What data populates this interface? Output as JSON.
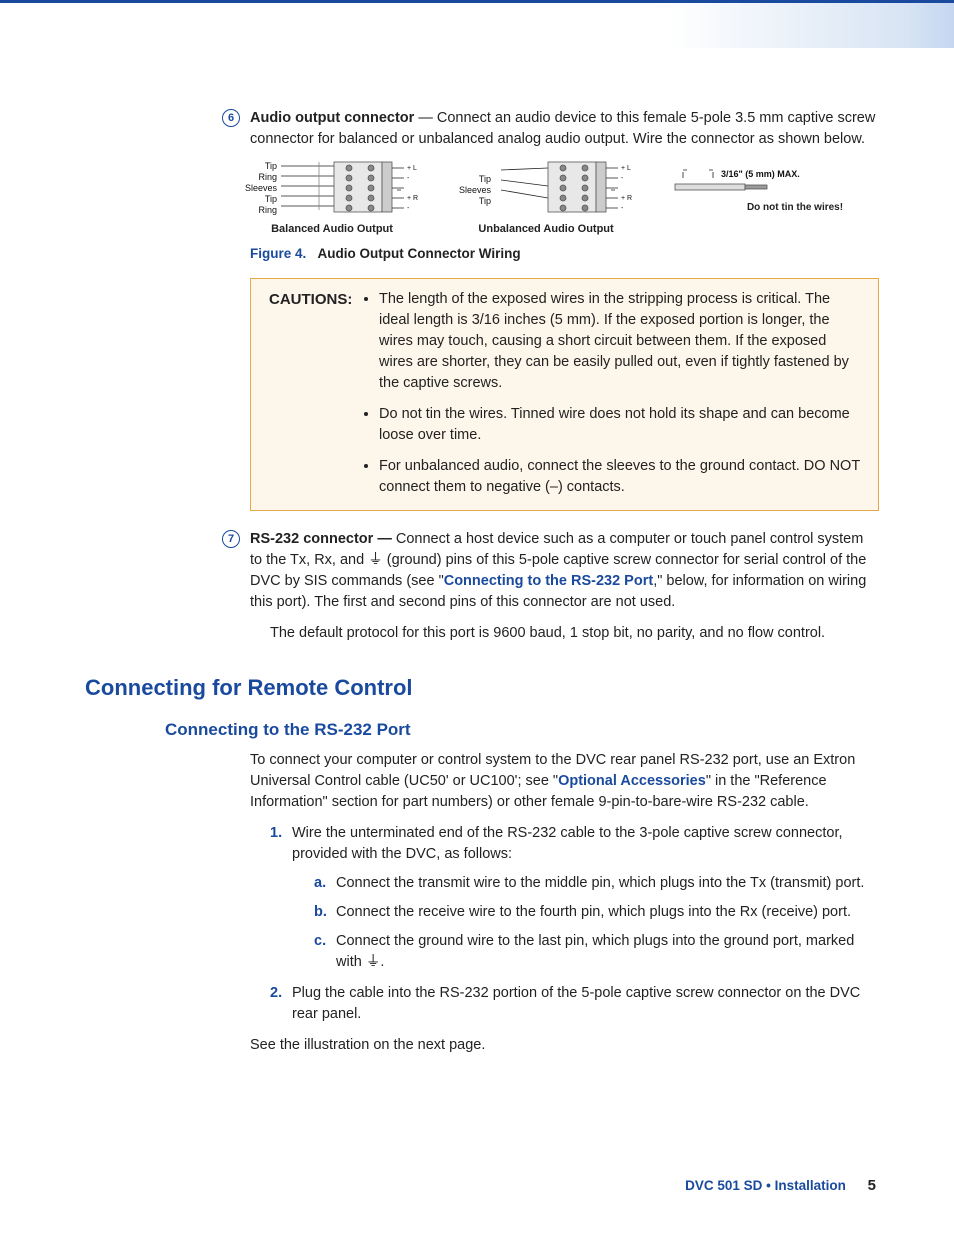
{
  "item6": {
    "num": "6",
    "title": "Audio output connector",
    "body_after_title": " — Connect an audio device to this female 5-pole 3.5 mm captive screw connector for balanced or unbalanced analog audio output. Wire the connector as shown below."
  },
  "diagrams": {
    "balanced": {
      "pin_labels": [
        "Tip",
        "Ring",
        "Sleeves",
        "Tip",
        "Ring"
      ],
      "caption": "Balanced Audio Output"
    },
    "unbalanced": {
      "pin_labels": [
        "Tip",
        "Sleeves",
        "Tip"
      ],
      "caption": "Unbalanced Audio Output"
    },
    "wire_spec": {
      "measure": "3/16\" (5 mm) MAX.",
      "note": "Do not tin the wires!"
    }
  },
  "figure": {
    "label": "Figure 4.",
    "title": "Audio Output Connector Wiring"
  },
  "cautions": {
    "label": "CAUTIONS:",
    "items": [
      "The length of the exposed wires in the stripping process is critical. The ideal length is 3/16 inches (5 mm). If the exposed portion is longer, the wires may touch, causing a short circuit between them. If the exposed wires are shorter, they can be easily pulled out, even if tightly fastened by the captive screws.",
      "Do not tin the wires. Tinned wire does not hold its shape and can become loose over time.",
      "For unbalanced audio, connect the sleeves to the ground contact. DO NOT connect them to negative (–) contacts."
    ]
  },
  "item7": {
    "num": "7",
    "title": "RS-232 connector —",
    "body1_a": " Connect a host device such as a computer or touch panel control system to the Tx, Rx, and ",
    "ground_sym": "⏚",
    "body1_b": " (ground) pins of this 5-pole captive screw connector for serial control of the DVC by SIS commands (see \"",
    "link": "Connecting to the RS-232 Port",
    "body1_c": ",\" below, for information on wiring this port). The first and second pins of this connector are not used.",
    "body2": "The default protocol for this port is 9600 baud, 1 stop bit, no parity, and no flow control."
  },
  "section": {
    "h2": "Connecting for Remote Control",
    "h3": "Connecting to the RS-232 Port",
    "intro_a": "To connect your computer or control system to the DVC rear panel RS-232 port, use an Extron Universal Control cable (UC50' or UC100'; see \"",
    "intro_link": "Optional Accessories",
    "intro_b": "\" in the \"Reference Information\" section for part numbers) or other female 9-pin-to-bare-wire RS-232 cable.",
    "step1": "Wire the unterminated end of the RS-232 cable to the 3-pole captive screw connector, provided with the DVC, as follows:",
    "step1a": "Connect the transmit wire to the middle pin, which plugs into the Tx (transmit) port.",
    "step1b": "Connect the receive wire to the fourth pin, which plugs into the Rx (receive) port.",
    "step1c_a": "Connect the ground wire to the last pin, which plugs into the ground port, marked with ",
    "step1c_sym": "⏚",
    "step1c_b": ".",
    "step2": "Plug the cable into the RS-232 portion of the 5-pole captive screw connector on the DVC rear panel.",
    "closing": "See the illustration on the next page."
  },
  "footer": {
    "text": "DVC 501 SD • Installation",
    "page": "5"
  }
}
